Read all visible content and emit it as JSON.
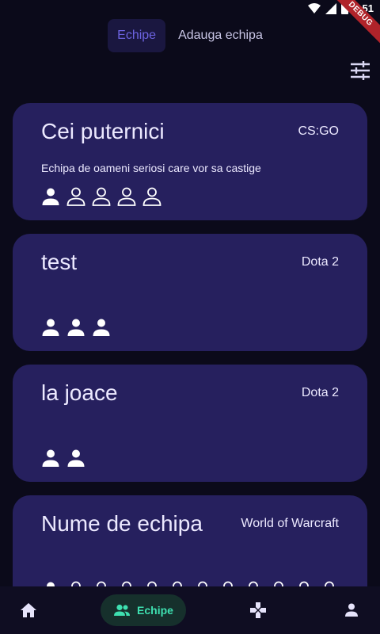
{
  "status_bar": {
    "time": "9:51",
    "debug_label": "DEBUG"
  },
  "tabs": [
    {
      "label": "Echipe",
      "active": true
    },
    {
      "label": "Adauga echipa",
      "active": false
    }
  ],
  "filter_icon": "tune-icon",
  "teams": [
    {
      "name": "Cei puternici",
      "game": "CS:GO",
      "description": "Echipa de oameni seriosi care vor sa castige",
      "members_filled": 1,
      "members_total": 5
    },
    {
      "name": "test",
      "game": "Dota 2",
      "description": "",
      "members_filled": 3,
      "members_total": 3
    },
    {
      "name": "la joace",
      "game": "Dota 2",
      "description": "",
      "members_filled": 2,
      "members_total": 2
    },
    {
      "name": "Nume de echipa",
      "game": "World of Warcraft",
      "description": "",
      "members_filled": 1,
      "members_total": 12
    }
  ],
  "bottom_nav": {
    "items": [
      {
        "icon": "home-icon",
        "label": ""
      },
      {
        "icon": "group-icon",
        "label": "Echipe",
        "active": true
      },
      {
        "icon": "gamepad-icon",
        "label": ""
      },
      {
        "icon": "person-icon",
        "label": ""
      }
    ]
  },
  "colors": {
    "background": "#0b0a1a",
    "card": "#26205e",
    "accent_tab": "#6c63e0",
    "nav_active": "#3ee0b0"
  }
}
